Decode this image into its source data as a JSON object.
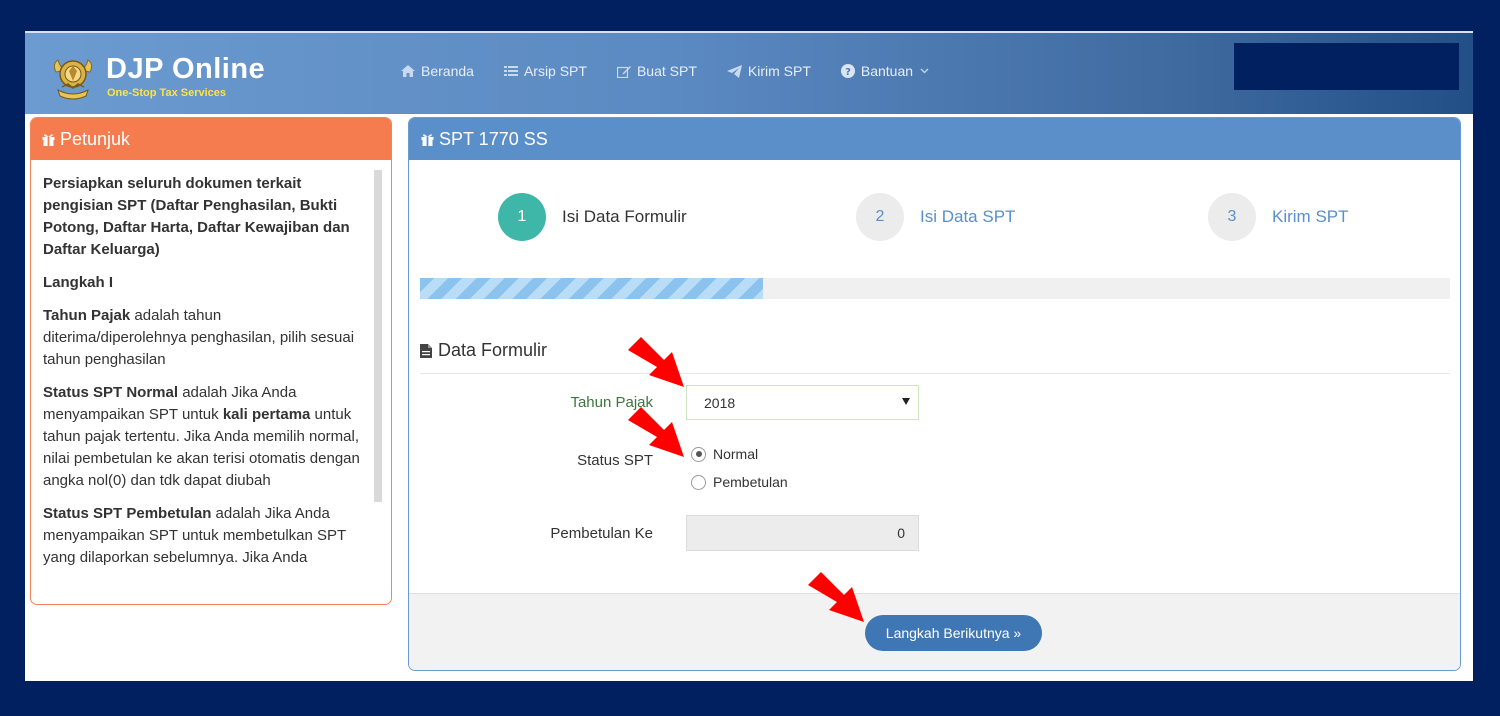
{
  "header": {
    "brand_title": "DJP Online",
    "brand_subtitle": "One-Stop Tax Services",
    "nav": [
      {
        "label": "Beranda",
        "icon": "home-icon"
      },
      {
        "label": "Arsip SPT",
        "icon": "list-icon"
      },
      {
        "label": "Buat SPT",
        "icon": "edit-icon"
      },
      {
        "label": "Kirim SPT",
        "icon": "send-icon"
      },
      {
        "label": "Bantuan",
        "icon": "question-circle-icon"
      }
    ]
  },
  "sidebar": {
    "title": "Petunjuk",
    "intro": "Persiapkan seluruh dokumen terkait pengisian SPT (Daftar Penghasilan, Bukti Potong, Daftar Harta, Daftar Kewajiban dan Daftar Keluarga)",
    "step_heading": "Langkah I",
    "tahun_term": "Tahun Pajak",
    "tahun_text": " adalah tahun diterima/diperolehnya penghasilan, pilih sesuai tahun penghasilan",
    "normal_term": "Status SPT Normal",
    "normal_text_1": " adalah Jika Anda menyampaikan SPT untuk ",
    "normal_emphasis": "kali pertama",
    "normal_text_2": " untuk tahun pajak tertentu. Jika Anda memilih normal, nilai pembetulan ke akan terisi otomatis dengan angka nol(0) dan tdk dapat diubah",
    "pembetulan_term": "Status SPT Pembetulan",
    "pembetulan_text": " adalah Jika Anda menyampaikan SPT untuk membetulkan SPT yang dilaporkan sebelumnya. Jika Anda"
  },
  "main": {
    "title": "SPT 1770 SS",
    "steps": [
      {
        "number": "1",
        "label": "Isi Data Formulir",
        "active": true
      },
      {
        "number": "2",
        "label": "Isi Data SPT",
        "active": false
      },
      {
        "number": "3",
        "label": "Kirim SPT",
        "active": false
      }
    ],
    "progress_fraction": 0.333,
    "section_title": "Data Formulir",
    "form": {
      "tahun_label": "Tahun Pajak",
      "tahun_value": "2018",
      "status_label": "Status SPT",
      "status_options": [
        "Normal",
        "Pembetulan"
      ],
      "status_selected": "Normal",
      "pembetulan_label": "Pembetulan Ke",
      "pembetulan_value": "0"
    },
    "next_button": "Langkah Berikutnya »"
  },
  "colors": {
    "background": "#002060",
    "sidebar_header": "#f47c4f",
    "main_header": "#5a8fca",
    "step_active": "#3fb7a8",
    "button": "#3f77b4",
    "annotation_arrow": "#ff0000"
  }
}
